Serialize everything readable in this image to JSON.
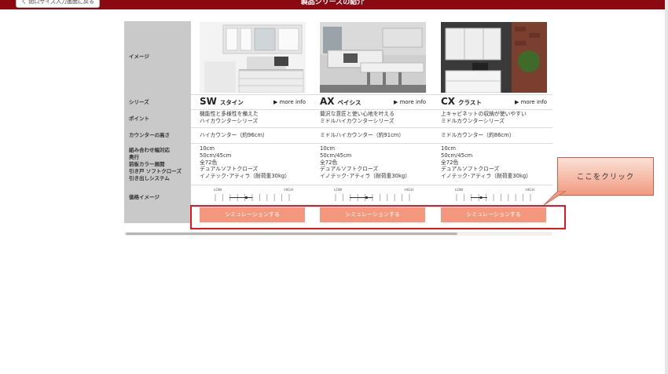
{
  "header": {
    "back_label": "く 間口サイズ入力画面に戻る",
    "title": "製品シリーズの紹介"
  },
  "row_labels": [
    "イメージ",
    "シリーズ",
    "ポイント",
    "カウンターの高さ",
    "組み合わせ幅対応",
    "奥行",
    "前板カラー展開",
    "引き戸 ソフトクローズ",
    "引き出しシステム",
    "価格イメージ"
  ],
  "price_scale": {
    "low": "LOW",
    "high": "HIGH"
  },
  "products": [
    {
      "code": "SW",
      "kana": "スタイン",
      "more": "▶ more info",
      "point": [
        "機能性と多様性を備えた",
        "ハイカウンターシリーズ"
      ],
      "height": "ハイカウンター（約96cm）",
      "specs": [
        "10cm",
        "50cm/45cm",
        "全72色",
        "デュアルソフトクローズ",
        "イノテック･アティラ（耐荷重30kg）"
      ],
      "price_level": 0.42,
      "button": "シミュレーションする"
    },
    {
      "code": "AX",
      "kana": "ベイシス",
      "more": "▶ more info",
      "point": [
        "贅沢な意匠と使い心地を叶える",
        "ミドルハイカウンターシリーズ"
      ],
      "height": "ミドルハイカウンター（約91cm）",
      "specs": [
        "10cm",
        "50cm/45cm",
        "全72色",
        "デュアルソフトクローズ",
        "イノテック･アティラ（耐荷重30kg）"
      ],
      "price_level": 0.42,
      "button": "シミュレーションする"
    },
    {
      "code": "CX",
      "kana": "クラスト",
      "more": "▶ more info",
      "point": [
        "上キャビネットの収納が使いやすい",
        "ミドルカウンターシリーズ"
      ],
      "height": "ミドルカウンター（約86cm）",
      "specs": [
        "10cm",
        "50cm/45cm",
        "全72色",
        "デュアルソフトクローズ",
        "イノテック･アティラ（耐荷重30kg）"
      ],
      "price_level": 0.33,
      "button": "シミュレーションする"
    }
  ],
  "callout": "ここをクリック"
}
